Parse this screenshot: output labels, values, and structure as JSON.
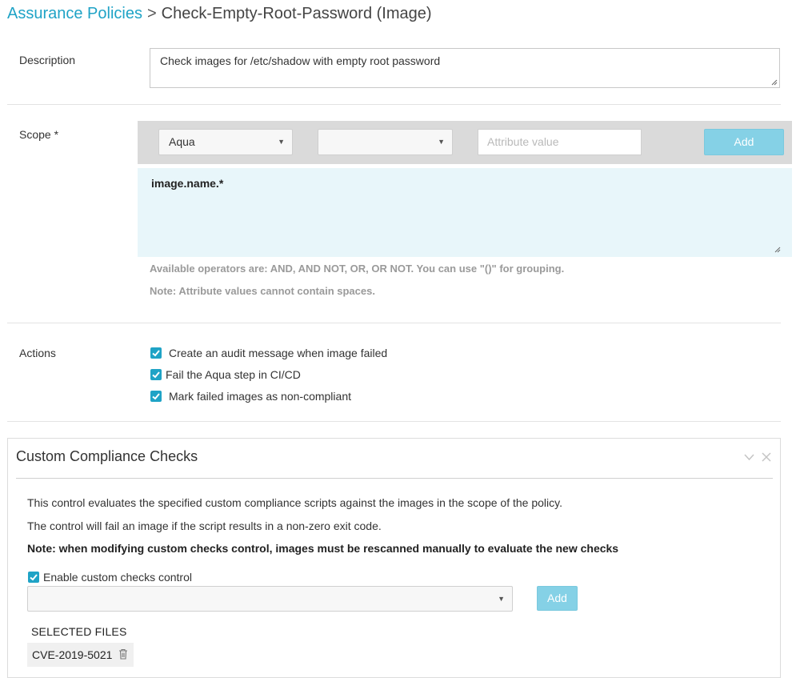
{
  "breadcrumb": {
    "parent": "Assurance Policies",
    "separator": ">",
    "current": "Check-Empty-Root-Password (Image)"
  },
  "description": {
    "label": "Description",
    "value": "Check images for /etc/shadow with empty root password"
  },
  "scope": {
    "label": "Scope *",
    "select1_value": "Aqua",
    "select2_value": "",
    "attribute_placeholder": "Attribute value",
    "add_label": "Add",
    "expression": "image.name.*",
    "help_operators": "Available operators are: AND, AND NOT, OR, OR NOT. You can use \"()\" for grouping.",
    "help_note": "Note: Attribute values cannot contain spaces."
  },
  "actions": {
    "label": "Actions",
    "items": [
      {
        "label": "Create an audit message when image failed",
        "checked": true
      },
      {
        "label": "Fail the Aqua step in CI/CD",
        "checked": true
      },
      {
        "label": "Mark failed images as non-compliant",
        "checked": true
      }
    ]
  },
  "custom_checks": {
    "title": "Custom Compliance Checks",
    "line1": "This control evaluates the specified custom compliance scripts against the images in the scope of the policy.",
    "line2": "The control will fail an image if the script results in a non-zero exit code.",
    "note": "Note: when modifying custom checks control, images must be rescanned manually to evaluate the new checks",
    "enable_label": "Enable custom checks control",
    "enable_checked": true,
    "script_select_value": "",
    "add_label": "Add",
    "selected_files_header": "SELECTED FILES",
    "selected_files": [
      "CVE-2019-5021"
    ]
  },
  "colors": {
    "accent": "#1fa3c6",
    "add_button": "#85d1e6",
    "expression_bg": "#e8f6fa"
  }
}
